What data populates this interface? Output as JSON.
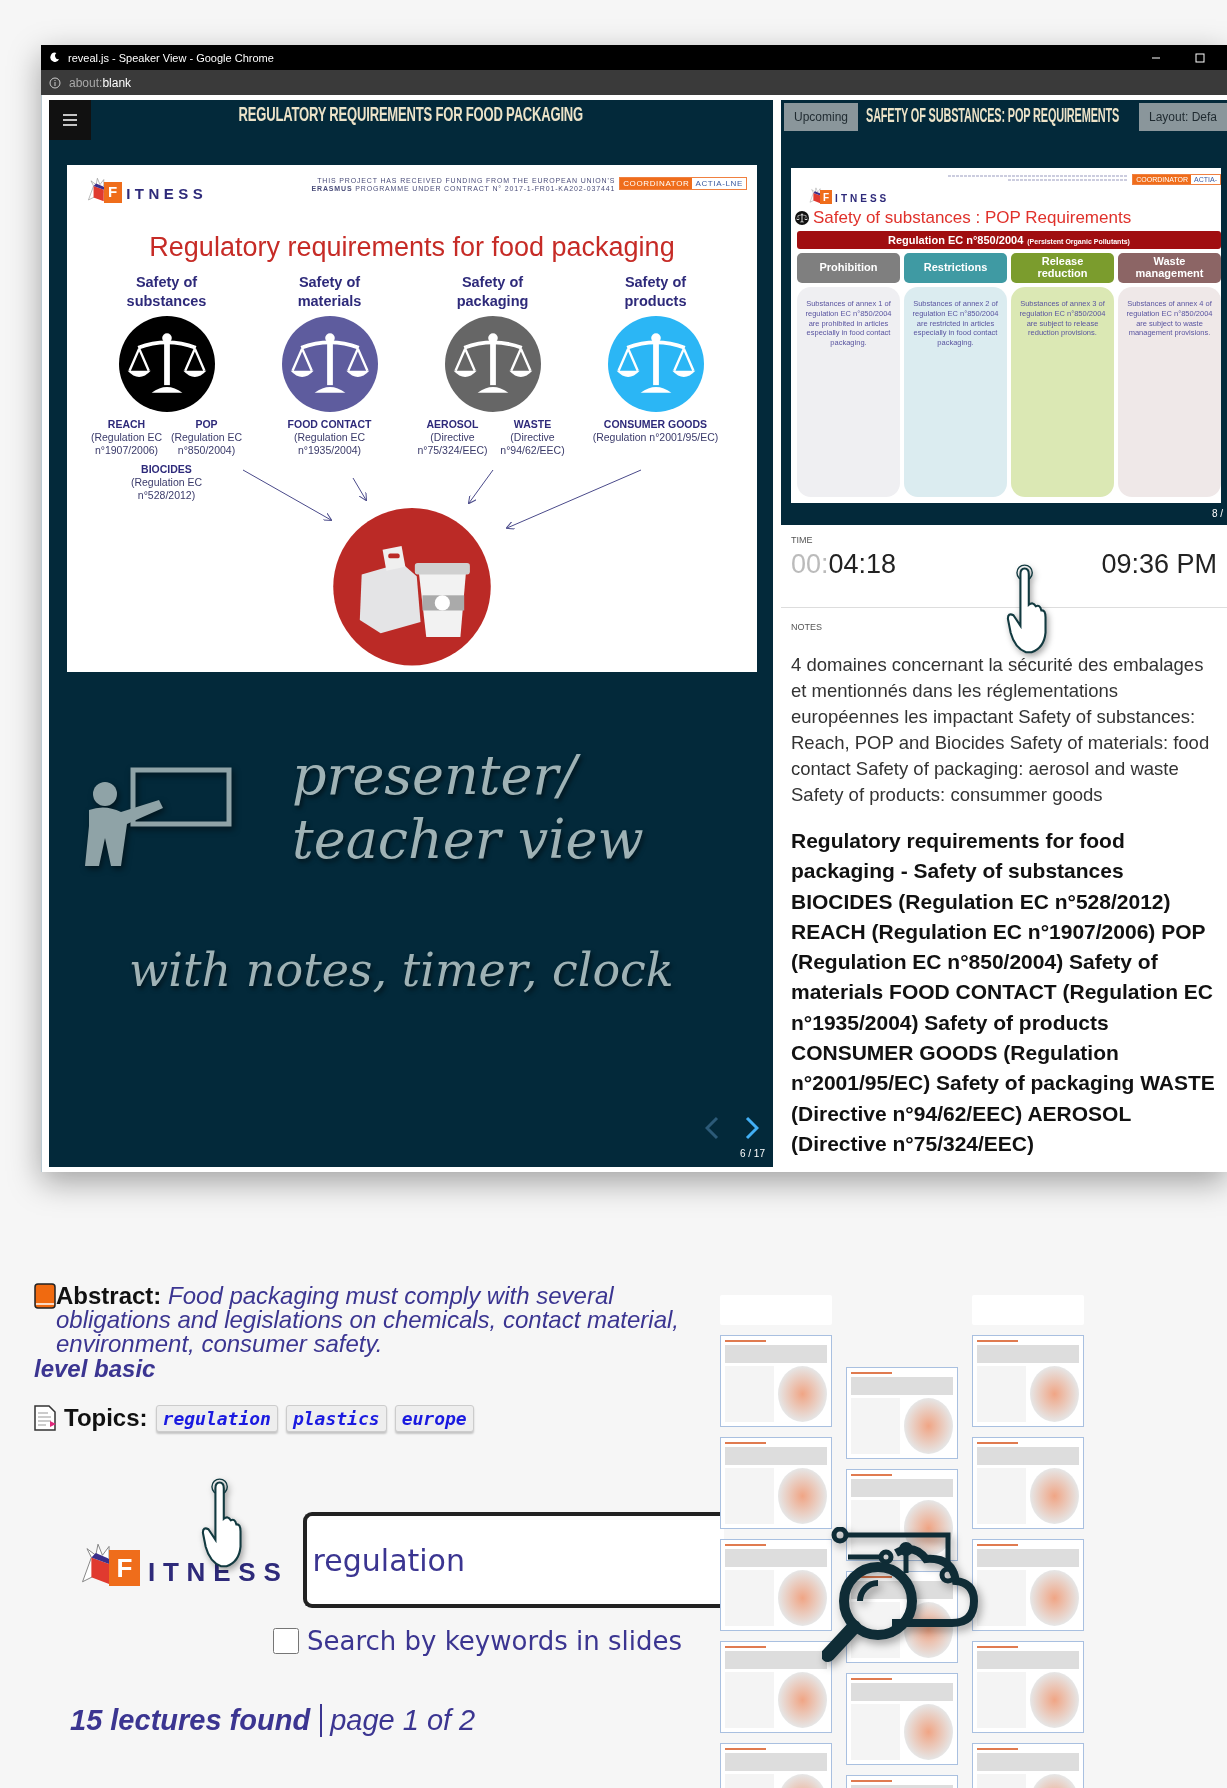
{
  "window": {
    "title": "reveal.js - Speaker View - Google Chrome",
    "address_scheme": "about:",
    "address_host": "blank"
  },
  "current": {
    "header": "REGULATORY REQUIREMENTS FOR FOOD PACKAGING",
    "slide": {
      "logo_initial": "F",
      "logo_text": "ITNESS",
      "funding": "THIS PROJECT HAS RECEIVED FUNDING FROM THE EUROPEAN UNION'S **ERASMUS** PROGRAMME UNDER CONTRACT N° 2017-1-FR01-KA202-037441",
      "coordinator_label": "COORDINATOR",
      "coordinator": "ACTIA-LNE",
      "title": "Regulatory requirements for food packaging",
      "categories": [
        {
          "title": "Safety of substances",
          "color": "#000000",
          "regulations": [
            {
              "name": "REACH",
              "detail": "(Regulation EC n°1907/2006)"
            },
            {
              "name": "POP",
              "detail": "(Regulation EC n°850/2004)"
            },
            {
              "name": "BIOCIDES",
              "detail": "(Regulation EC n°528/2012)"
            }
          ]
        },
        {
          "title": "Safety of materials",
          "color": "#5e5c9e",
          "regulations": [
            {
              "name": "FOOD CONTACT",
              "detail": "(Regulation EC n°1935/2004)"
            }
          ]
        },
        {
          "title": "Safety of packaging",
          "color": "#666666",
          "regulations": [
            {
              "name": "AEROSOL",
              "detail": "(Directive n°75/324/EEC)"
            },
            {
              "name": "WASTE",
              "detail": "(Directive n°94/62/EEC)"
            }
          ]
        },
        {
          "title": "Safety of products",
          "color": "#2bb6f5",
          "regulations": [
            {
              "name": "CONSUMER GOODS",
              "detail": "(Regulation n°2001/95/EC)"
            }
          ]
        }
      ]
    },
    "overlay": {
      "line_1": "presenter/",
      "line_2": "teacher view",
      "line_3": "with notes, timer, clock"
    },
    "counter": "6 / 17"
  },
  "upcoming": {
    "button": "Upcoming",
    "header": "SAFETY OF SUBSTANCES: POP REQUIREMENTS",
    "layout_button": "Layout: Defa",
    "slide": {
      "logo_initial": "F",
      "logo_text": "ITNESS",
      "coordinator_label": "COORDINATOR",
      "coordinator": "ACTIA-",
      "title": "Safety of substances : POP Requirements",
      "regulation": "Regulation EC n°850/2004",
      "regulation_note": "(Persistent Organic Pollutants)",
      "columns": [
        {
          "heading": "Prohibition",
          "color": "#7f7f7f",
          "body": {
            "text": "Substances of annex 1 of regulation EC n°850/2004 are prohibited in articles especially in food contact packaging.",
            "color": "#efeff2"
          }
        },
        {
          "heading": "Restrictions",
          "color": "#3f9aa3",
          "body": {
            "text": "Substances of annex 2 of regulation EC n°850/2004 are restricted in articles especially in food contact packaging.",
            "color": "#dbecf0"
          }
        },
        {
          "heading": "Release reduction",
          "color": "#7b9c2d",
          "body": {
            "text": "Substances of annex 3 of regulation EC n°850/2004 are subject to release reduction provisions.",
            "color": "#dbe8b4"
          }
        },
        {
          "heading": "Waste management",
          "color": "#8c6565",
          "body": {
            "text": "Substances of annex 4 of regulation EC n°850/2004 are subject to waste management provisions.",
            "color": "#efe8e8"
          }
        }
      ]
    },
    "counter": "8 /"
  },
  "timer": {
    "label": "TIME",
    "elapsed_dim": "00:",
    "elapsed": "04:18",
    "clock": "09:36 PM"
  },
  "notes": {
    "label": "NOTES",
    "text": "4 domaines concernant la sécurité des embalages et mentionnés dans les réglementations européennes les impactant Safety of substances: Reach, POP and Biocides Safety of materials: food contact Safety of packaging: aerosol and waste Safety of products: consummer goods",
    "summary": "Regulatory requirements for food packaging - Safety of substances BIOCIDES (Regulation EC n°528/2012) REACH (Regulation EC n°1907/2006) POP (Regulation EC n°850/2004) Safety of materials FOOD CONTACT (Regulation EC n°1935/2004) Safety of products CONSUMER GOODS (Regulation n°2001/95/EC) Safety of packaging WASTE (Directive n°94/62/EEC) AEROSOL (Directive n°75/324/EEC)"
  },
  "lecture": {
    "abstract_label": "Abstract:",
    "abstract": "Food packaging must comply with several obligations and legislations on chemicals, contact material, environment, consumer safety.",
    "level": "level basic",
    "topics_label": "Topics:",
    "topics": [
      "regulation",
      "plastics",
      "europe"
    ],
    "logo_initial": "F",
    "logo_text": "ITNESS",
    "search": {
      "value": "regulation"
    },
    "keyword_option": {
      "label": "Search by keywords in slides",
      "checked": false
    },
    "results": "15 lectures found",
    "page": "page 1 of 2"
  }
}
